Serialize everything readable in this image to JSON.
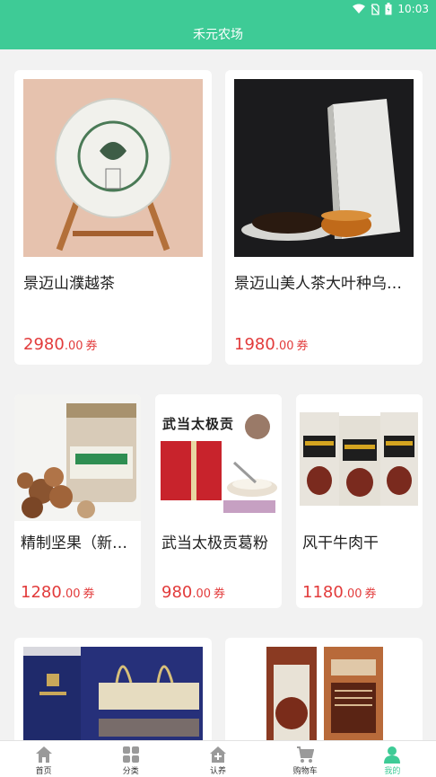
{
  "status_bar": {
    "time": "10:03",
    "icons": [
      "wifi-icon",
      "no-sim-icon",
      "battery-icon"
    ]
  },
  "app_bar": {
    "title": "禾元农场"
  },
  "products": [
    {
      "name": "景迈山濮越茶",
      "price_int": "2980",
      "price_dec": ".00",
      "unit": "券",
      "image": "pu-erh-tea-cake-image"
    },
    {
      "name": "景迈山美人茶大叶种乌…",
      "price_int": "1980",
      "price_dec": ".00",
      "unit": "券",
      "image": "oolong-tea-box-image"
    },
    {
      "name": "精制坚果（新…",
      "price_int": "1280",
      "price_dec": ".00",
      "unit": "券",
      "image": "nut-jar-image"
    },
    {
      "name": "武当太极贡葛粉",
      "price_int": "980",
      "price_dec": ".00",
      "unit": "券",
      "image": "kudzu-powder-giftbox-image",
      "image_text": "武当太极贡"
    },
    {
      "name": "风干牛肉干",
      "price_int": "1180",
      "price_dec": ".00",
      "unit": "券",
      "image": "beef-jerky-packs-image"
    },
    {
      "name": "",
      "image": "gift-bag-image"
    },
    {
      "name": "",
      "image": "buckwheat-noodles-image"
    }
  ],
  "tabs": [
    {
      "label": "首页",
      "icon": "home-icon"
    },
    {
      "label": "分类",
      "icon": "category-icon"
    },
    {
      "label": "认养",
      "icon": "adopt-icon"
    },
    {
      "label": "购物车",
      "icon": "cart-icon"
    },
    {
      "label": "我的",
      "icon": "profile-icon",
      "active": true
    }
  ],
  "colors": {
    "accent": "#3ecb96",
    "price": "#e23b3b",
    "background": "#f2f2f2"
  }
}
